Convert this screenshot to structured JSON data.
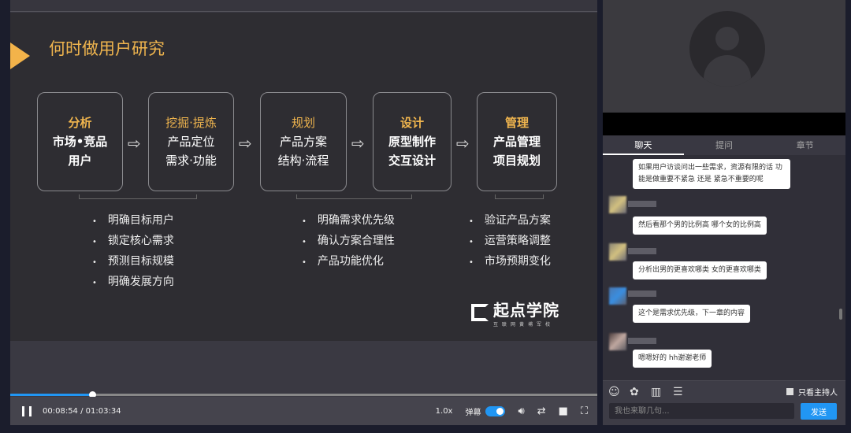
{
  "slide": {
    "title": "何时做用户研究",
    "boxes": [
      {
        "head": "分析",
        "l1": "市场•竞品",
        "l2": "用户"
      },
      {
        "head": "挖掘·提炼",
        "l1": "产品定位",
        "l2": "需求·功能"
      },
      {
        "head": "规划",
        "l1": "产品方案",
        "l2": "结构·流程"
      },
      {
        "head": "设计",
        "l1": "原型制作",
        "l2": "交互设计"
      },
      {
        "head": "管理",
        "l1": "产品管理",
        "l2": "项目规划"
      }
    ],
    "bullets1": [
      "明确目标用户",
      "锁定核心需求",
      "预测目标规模",
      "明确发展方向"
    ],
    "bullets2": [
      "明确需求优先级",
      "确认方案合理性",
      "产品功能优化"
    ],
    "bullets3": [
      "验证产品方案",
      "运营策略调整",
      "市场预期变化"
    ],
    "logo": {
      "name": "起点学院",
      "sub": "互联网黄埔军校"
    }
  },
  "player": {
    "time": "00:08:54 / 01:03:34",
    "progress": 0.14,
    "speed": "1.0x",
    "danmaku": "弹幕",
    "danmaku_on": true
  },
  "side": {
    "tabs": [
      "聊天",
      "提问",
      "章节"
    ],
    "messages": [
      "如果用户访谈问出一些需求，资源有限的话 功能是做重要不紧急 还是 紧急不重要的呢",
      "然后看那个男的比例高 哪个女的比例高",
      "分析出男的更喜欢哪类 女的更喜欢哪类",
      "这个是需求优先级，下一章的内容",
      "嗯嗯好的 hh谢谢老师"
    ],
    "only_host": "只看主持人",
    "placeholder": "我也来聊几句...",
    "send": "发送"
  },
  "colors": {
    "accent": "#f0b54e",
    "blue": "#2196f3"
  }
}
